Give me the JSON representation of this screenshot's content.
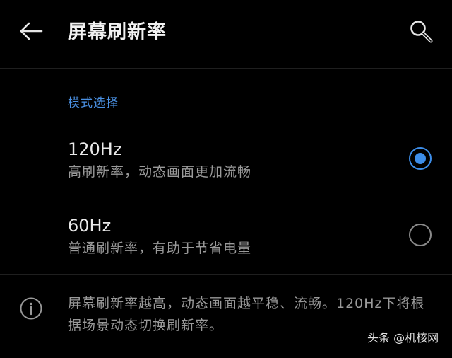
{
  "header": {
    "title": "屏幕刷新率",
    "back_icon": "arrow-left-icon",
    "search_icon": "search-icon"
  },
  "mode_section": {
    "label": "模式选择",
    "accent_color": "#4a90e2",
    "options": [
      {
        "title": "120Hz",
        "description": "高刷新率，动态画面更加流畅",
        "selected": true
      },
      {
        "title": "60Hz",
        "description": "普通刷新率，有助于节省电量",
        "selected": false
      }
    ]
  },
  "info": {
    "icon": "info-icon",
    "text": "屏幕刷新率越高，动态画面越平稳、流畅。120Hz下将根据场景动态切换刷新率。"
  },
  "watermark": {
    "text": "头条 @机核网"
  }
}
